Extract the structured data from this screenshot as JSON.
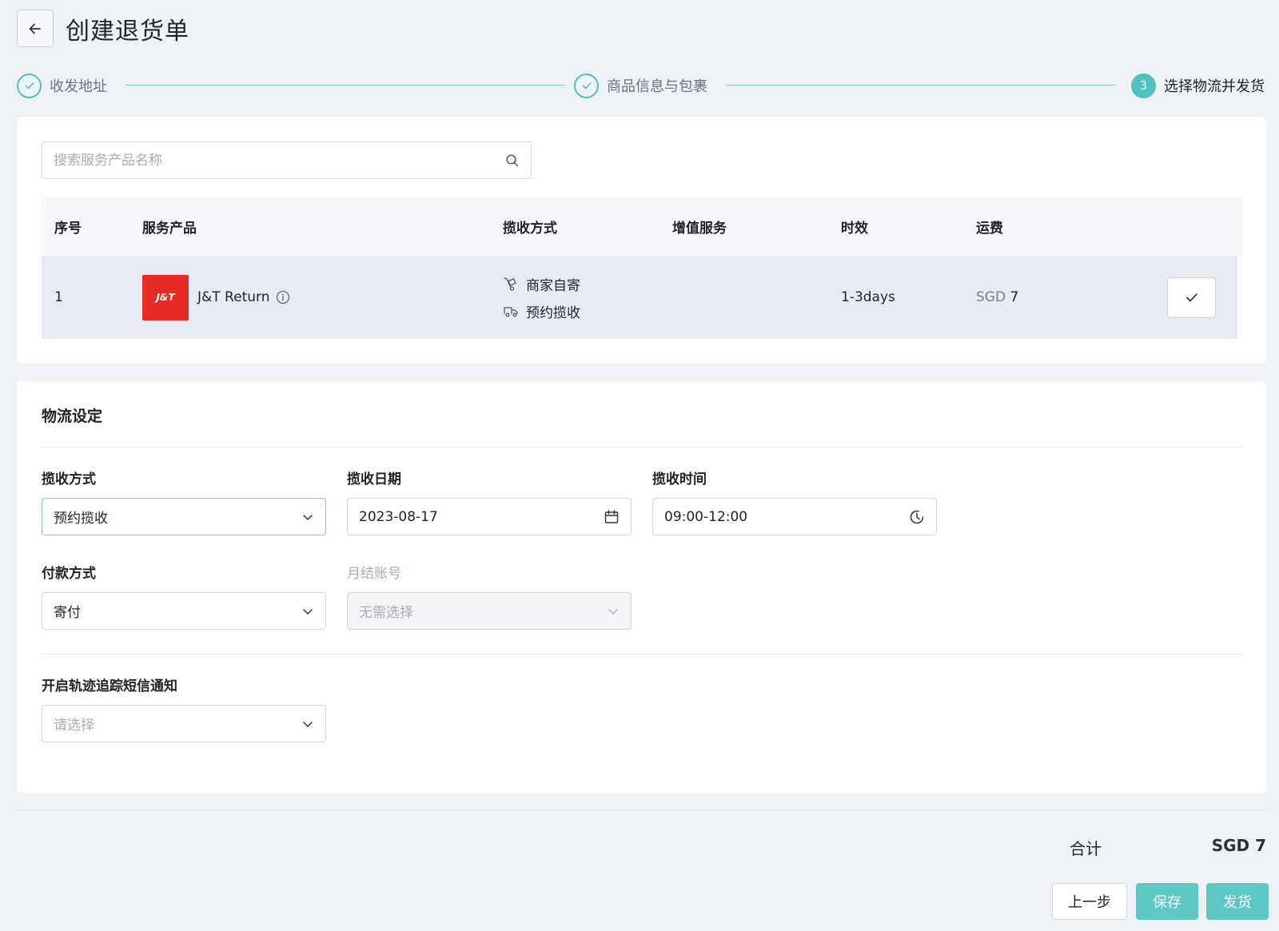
{
  "header": {
    "title": "创建退货单"
  },
  "steps": [
    {
      "label": "收发地址",
      "status": "done"
    },
    {
      "label": "商品信息与包裹",
      "status": "done"
    },
    {
      "number": "3",
      "label": "选择物流并发货",
      "status": "active"
    }
  ],
  "search": {
    "placeholder": "搜索服务产品名称"
  },
  "table": {
    "headers": [
      "序号",
      "服务产品",
      "揽收方式",
      "增值服务",
      "时效",
      "运费"
    ],
    "rows": [
      {
        "index": "1",
        "logo_text": "J&T",
        "product": "J&T Return",
        "methods": [
          "商家自寄",
          "预约揽收"
        ],
        "value_added": "",
        "timeliness": "1-3days",
        "fee_currency": "SGD",
        "fee_amount": "7"
      }
    ]
  },
  "logistics": {
    "title": "物流设定",
    "pickup_method": {
      "label": "揽收方式",
      "value": "预约揽收"
    },
    "pickup_date": {
      "label": "揽收日期",
      "value": "2023-08-17"
    },
    "pickup_time": {
      "label": "揽收时间",
      "value": "09:00-12:00"
    },
    "payment_method": {
      "label": "付款方式",
      "value": "寄付"
    },
    "monthly_account": {
      "label": "月结账号",
      "value": "无需选择"
    },
    "sms_notify": {
      "label": "开启轨迹追踪短信通知",
      "placeholder": "请选择"
    }
  },
  "footer": {
    "total_label": "合计",
    "total_value": "SGD 7",
    "prev_label": "上一步",
    "save_label": "保存",
    "ship_label": "发货"
  },
  "colors": {
    "accent": "#4fc1bf",
    "button": "#5ec8c4",
    "logo_red": "#e62b26",
    "row_selected": "#e7ecf4"
  }
}
